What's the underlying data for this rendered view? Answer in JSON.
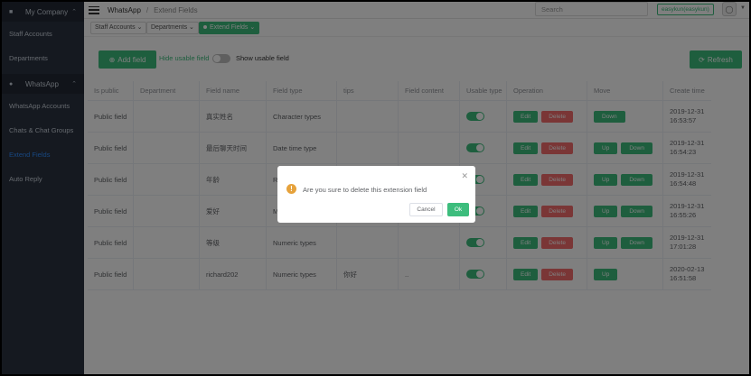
{
  "sidebar": {
    "company": "My Company",
    "items_top": [
      {
        "label": "Staff Accounts"
      },
      {
        "label": "Departments"
      }
    ],
    "whatsapp_group": "WhatsApp",
    "items_bottom": [
      {
        "label": "WhatsApp Accounts"
      },
      {
        "label": "Chats & Chat Groups"
      },
      {
        "label": "Extend Fields",
        "active": true
      },
      {
        "label": "Auto Reply"
      }
    ]
  },
  "topbar": {
    "crumb_root": "WhatsApp",
    "crumb_sep": "/",
    "crumb_current": "Extend Fields",
    "search_placeholder": "Search",
    "user": "easykun(easykun)"
  },
  "tags": [
    {
      "label": "Staff Accounts"
    },
    {
      "label": "Departments"
    },
    {
      "label": "Extend Fields",
      "active": true
    }
  ],
  "toolbar": {
    "add_field": "Add field",
    "hide_usable": "Hide usable field",
    "show_usable": "Show usable field",
    "refresh": "Refresh"
  },
  "table": {
    "headers": [
      "Is public",
      "Department",
      "Field name",
      "Field type",
      "tips",
      "Field content",
      "Usable type",
      "Operation",
      "Move",
      "Create time"
    ],
    "edit_label": "Edit",
    "delete_label": "Delete",
    "up_label": "Up",
    "down_label": "Down",
    "rows": [
      {
        "public": "Public field",
        "dept": "",
        "name": "真实姓名",
        "type": "Character types",
        "tips": "",
        "content": "",
        "usable": true,
        "up": false,
        "down": true,
        "date": "2019-12-31",
        "time": "16:53:57"
      },
      {
        "public": "Public field",
        "dept": "",
        "name": "最后聊天时间",
        "type": "Date time type",
        "tips": "",
        "content": "",
        "usable": true,
        "up": true,
        "down": true,
        "date": "2019-12-31",
        "time": "16:54:23"
      },
      {
        "public": "Public field",
        "dept": "",
        "name": "年龄",
        "type": "R",
        "tips": "",
        "content": "",
        "usable": true,
        "up": true,
        "down": true,
        "date": "2019-12-31",
        "time": "16:54:48"
      },
      {
        "public": "Public field",
        "dept": "",
        "name": "爱好",
        "type": "M",
        "tips": "",
        "content": "",
        "usable": true,
        "up": true,
        "down": true,
        "date": "2019-12-31",
        "time": "16:55:26"
      },
      {
        "public": "Public field",
        "dept": "",
        "name": "等级",
        "type": "Numeric types",
        "tips": "",
        "content": "",
        "usable": true,
        "up": true,
        "down": true,
        "date": "2019-12-31",
        "time": "17:01:28"
      },
      {
        "public": "Public field",
        "dept": "",
        "name": "richard202",
        "type": "Numeric types",
        "tips": "你好",
        "content": "..",
        "usable": true,
        "up": true,
        "down": false,
        "date": "2020-02-13",
        "time": "16:51:58"
      }
    ]
  },
  "dialog": {
    "message": "Are you sure to delete this extension field",
    "cancel": "Cancel",
    "ok": "Ok"
  },
  "colors": {
    "sidebar_bg": "#2b3340",
    "accent_green": "#3dbd7d",
    "danger_red": "#f56c6c",
    "active_link": "#2f8cff",
    "warning": "#e6a23c"
  }
}
